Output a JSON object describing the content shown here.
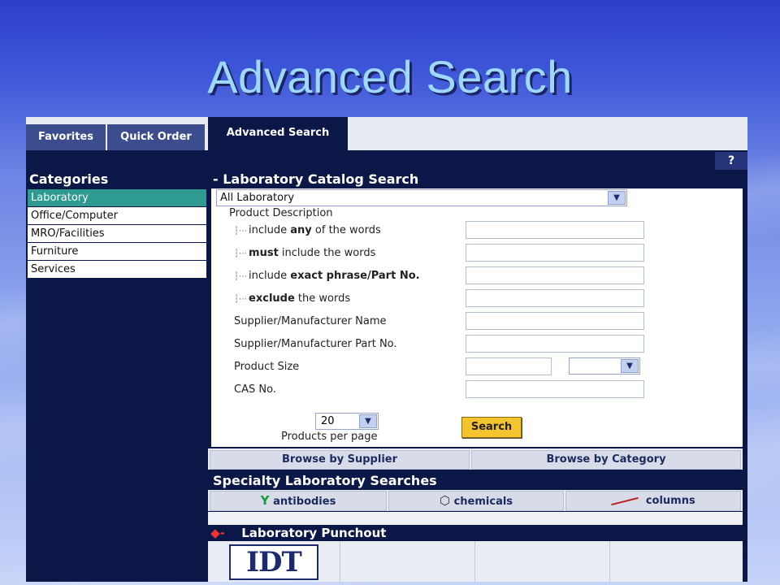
{
  "slide": {
    "title": "Advanced Search"
  },
  "tabs": [
    {
      "label": "Favorites",
      "active": false
    },
    {
      "label": "Quick Order",
      "active": false
    },
    {
      "label": "Advanced Search",
      "active": true
    }
  ],
  "help": {
    "label": "?"
  },
  "categories": {
    "heading": "Categories",
    "items": [
      {
        "label": "Laboratory",
        "selected": true
      },
      {
        "label": "Office/Computer",
        "selected": false
      },
      {
        "label": "MRO/Facilities",
        "selected": false
      },
      {
        "label": "Furniture",
        "selected": false
      },
      {
        "label": "Services",
        "selected": false
      }
    ]
  },
  "catalog_search": {
    "heading": "- Laboratory Catalog Search",
    "department_value": "All Laboratory",
    "product_description_label": "Product Description",
    "word_filters": [
      {
        "pre": "include ",
        "bold": "any",
        "post": " of the words",
        "value": ""
      },
      {
        "pre": "",
        "bold": "must",
        "post": " include the words",
        "value": ""
      },
      {
        "pre": "include ",
        "bold": "exact phrase/Part No.",
        "post": "",
        "value": ""
      },
      {
        "pre": "",
        "bold": "exclude",
        "post": " the words",
        "value": ""
      }
    ],
    "supplier_name_label": "Supplier/Manufacturer Name",
    "supplier_part_label": "Supplier/Manufacturer Part No.",
    "product_size_label": "Product Size",
    "product_size_unit": "",
    "cas_label": "CAS No.",
    "per_page_value": "20",
    "per_page_label": "Products per page",
    "search_button": "Search"
  },
  "browse": {
    "by_supplier": "Browse by Supplier",
    "by_category": "Browse by Category"
  },
  "specialty": {
    "heading": "Specialty Laboratory Searches",
    "items": [
      {
        "label": "antibodies",
        "icon": "antibody-icon"
      },
      {
        "label": "chemicals",
        "icon": "chemical-icon"
      },
      {
        "label": "columns",
        "icon": "column-icon"
      }
    ]
  },
  "punchout": {
    "heading": "Laboratory Punchout",
    "logos": [
      {
        "text": "IDT"
      }
    ]
  },
  "colors": {
    "nav_dark": "#0b1746",
    "tab_inactive": "#3b4d8c",
    "selected_category": "#2e9a90",
    "search_button": "#f4c430",
    "title_text": "#9fd8ff"
  }
}
